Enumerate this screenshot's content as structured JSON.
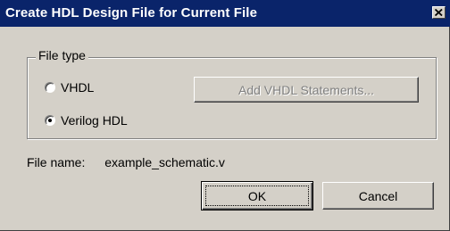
{
  "window": {
    "title": "Create HDL Design File for Current File",
    "close_glyph": "close-icon"
  },
  "file_type_group": {
    "legend": "File type",
    "options": [
      {
        "label": "VHDL",
        "checked": false
      },
      {
        "label": "Verilog HDL",
        "checked": true
      }
    ],
    "add_statements_label": "Add VHDL Statements...",
    "add_statements_enabled": false
  },
  "file_name": {
    "label": "File name:",
    "value": "example_schematic.v"
  },
  "buttons": {
    "ok_label": "OK",
    "cancel_label": "Cancel"
  },
  "colors": {
    "titlebar": "#0a246a",
    "dialog_face": "#d4d0c8",
    "disabled_text": "#808080"
  }
}
